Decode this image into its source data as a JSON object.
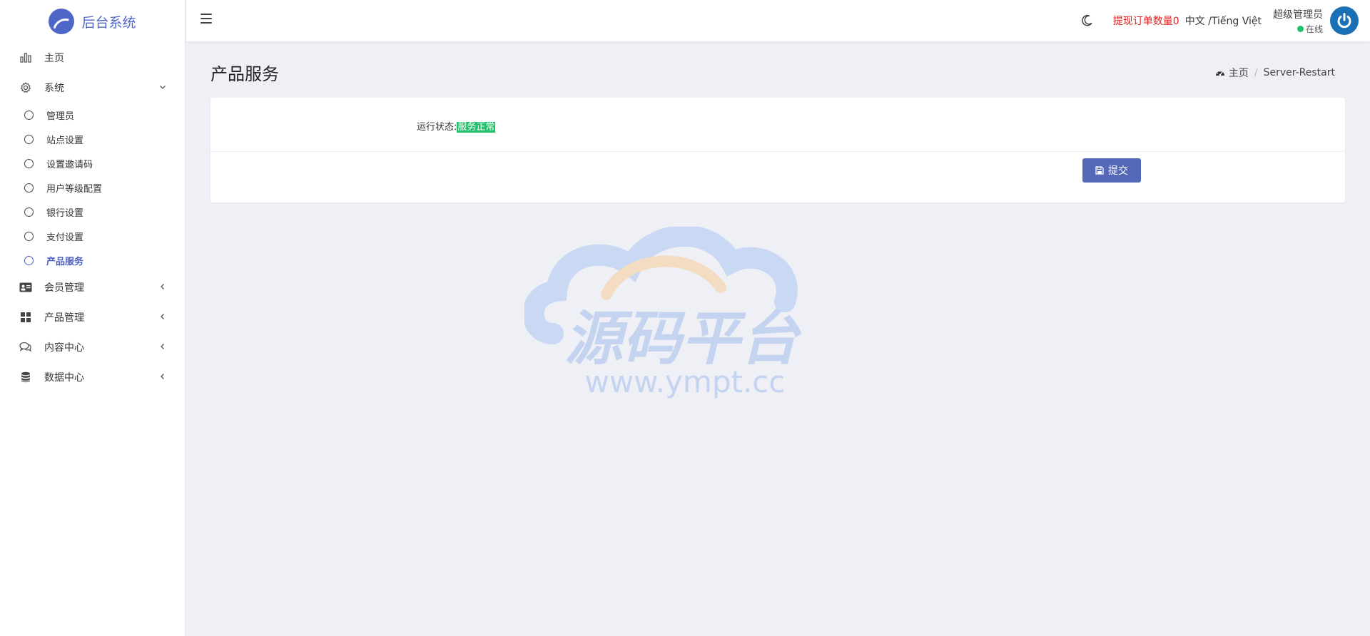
{
  "brand": {
    "name": "后台系统"
  },
  "sidebar": {
    "items": [
      {
        "label": "主页",
        "icon": "bar-chart-icon"
      },
      {
        "label": "系统",
        "icon": "gear-icon",
        "expanded": true,
        "children": [
          "管理员",
          "站点设置",
          "设置邀请码",
          "用户等级配置",
          "银行设置",
          "支付设置",
          "产品服务"
        ],
        "active_child": "产品服务"
      },
      {
        "label": "会员管理",
        "icon": "id-card-icon"
      },
      {
        "label": "产品管理",
        "icon": "grid-icon"
      },
      {
        "label": "内容中心",
        "icon": "chat-icon"
      },
      {
        "label": "数据中心",
        "icon": "database-icon"
      }
    ]
  },
  "header": {
    "withdraw_label": "提现订单数量0",
    "lang_label": "中文 /Tiếng Việt",
    "user_name": "超级管理员",
    "user_status": "在线"
  },
  "page": {
    "title": "产品服务",
    "breadcrumb": {
      "home": "主页",
      "current": "Server-Restart"
    },
    "status_label": "运行状态:",
    "status_value": "服务正常",
    "submit_label": "提交"
  },
  "watermark": {
    "text": "源码平台",
    "url": "www.ympt.cc"
  },
  "colors": {
    "accent": "#4f66c9",
    "button": "#5568b8",
    "status_ok": "#1fbf6b",
    "alert": "#e02020"
  }
}
